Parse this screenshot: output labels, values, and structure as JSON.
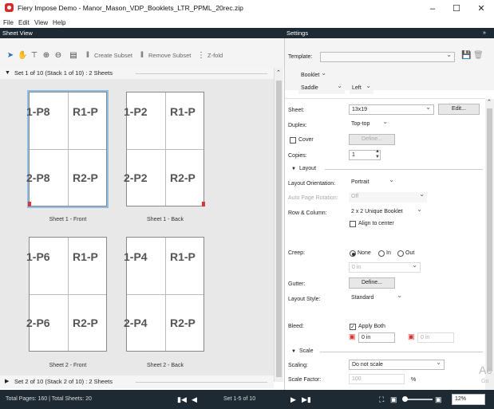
{
  "window": {
    "title": "Fiery Impose Demo - Manor_Mason_VDP_Booklets_LTR_PPML_20rec.zip",
    "minimize": "–",
    "maximize": "☐",
    "close": "✕"
  },
  "menu": [
    "File",
    "Edit",
    "View",
    "Help"
  ],
  "sheet_view": {
    "panel_title": "Sheet View",
    "toolbar": {
      "create_subset": "Create Subset",
      "remove_subset": "Remove Subset",
      "z_fold": "Z-fold"
    },
    "stack1_label": "Set 1 of 10 (Stack 1 of 10) : 2 Sheets",
    "stack2_label": "Set 2 of 10 (Stack 2 of 10) : 2 Sheets",
    "sheets": [
      {
        "label": "Sheet 1 - Front",
        "tl": "1-P8",
        "tr": "R1-P",
        "bl": "2-P8",
        "br": "R2-P"
      },
      {
        "label": "Sheet 1 - Back",
        "tl": "1-P2",
        "tr": "R1-P",
        "bl": "2-P2",
        "br": "R2-P"
      },
      {
        "label": "Sheet 2 - Front",
        "tl": "1-P6",
        "tr": "R1-P",
        "bl": "2-P6",
        "br": "R2-P"
      },
      {
        "label": "Sheet 2 - Back",
        "tl": "1-P4",
        "tr": "R1-P",
        "bl": "2-P4",
        "br": "R2-P"
      }
    ]
  },
  "settings": {
    "panel_title": "Settings",
    "template_label": "Template:",
    "template_value": "",
    "booklet_type": "Booklet",
    "binding": "Saddle",
    "binding_side": "Left",
    "sheet_label": "Sheet:",
    "sheet_value": "13x19",
    "edit_button": "Edit...",
    "duplex_label": "Duplex:",
    "duplex_value": "Top-top",
    "cover_label": "Cover",
    "define_button": "Define...",
    "copies_label": "Copies:",
    "copies_value": "1",
    "layout_section": "Layout",
    "layout_orientation_label": "Layout Orientation:",
    "layout_orientation_value": "Portrait",
    "auto_rotation_label": "Auto Page Rotation:",
    "auto_rotation_value": "Off",
    "row_col_label": "Row & Column:",
    "row_col_value": "2 x 2 Unique Booklet",
    "align_center_label": "Align to center",
    "creep_label": "Creep:",
    "creep_none": "None",
    "creep_in": "In",
    "creep_out": "Out",
    "creep_value": "0 in",
    "gutter_label": "Gutter:",
    "gutter_define": "Define...",
    "layout_style_label": "Layout Style:",
    "layout_style_value": "Standard",
    "bleed_label": "Bleed:",
    "apply_both_label": "Apply Both",
    "bleed_h_value": "0 in",
    "bleed_v_value": "0 in",
    "scale_section": "Scale",
    "scaling_label": "Scaling:",
    "scaling_value": "Do not scale",
    "scale_factor_label": "Scale Factor:",
    "scale_factor_value": "100",
    "scale_factor_unit": "%"
  },
  "status": {
    "totals": "Total Pages: 160 | Total Sheets: 20",
    "set_range": "Set 1-5 of 10",
    "zoom": "12%"
  },
  "watermark": "Ac",
  "watermark2": "Go"
}
